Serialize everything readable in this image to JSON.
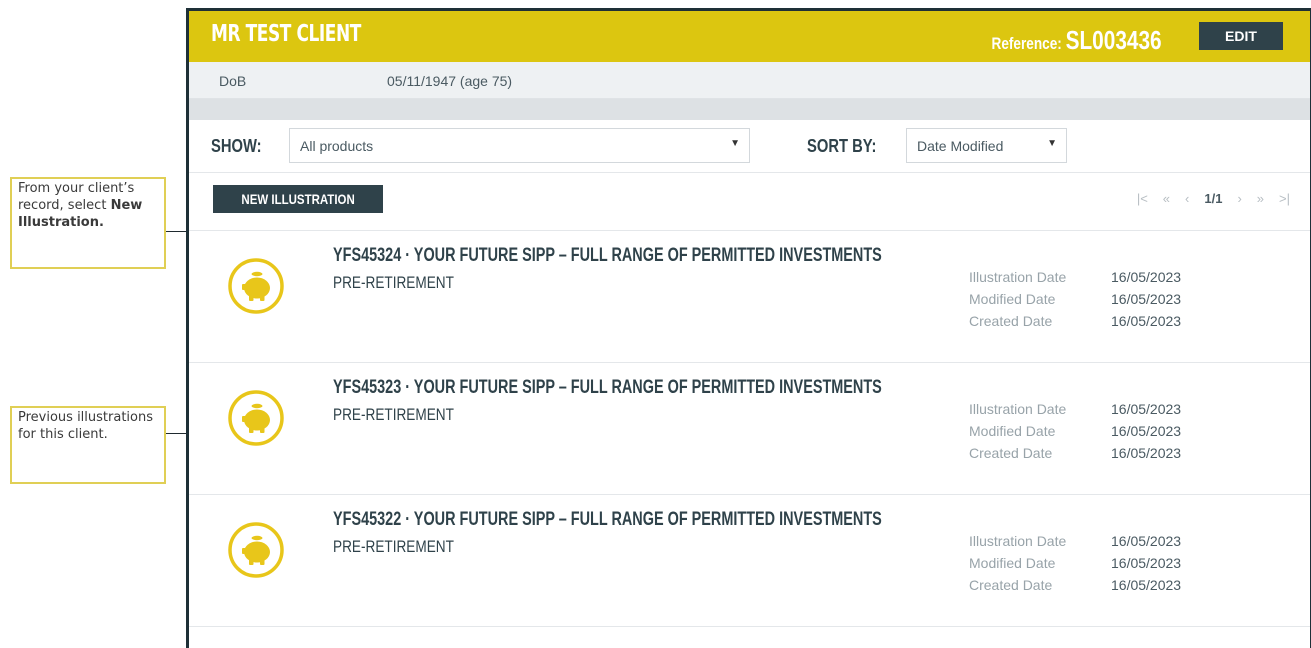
{
  "callouts": {
    "new_illustration_pre": "From your client’s record, select ",
    "new_illustration_bold": "New Illustration.",
    "previous": "Previous illustrations for this client."
  },
  "header": {
    "client_name": "MR TEST CLIENT",
    "reference_label": "Reference:",
    "reference_value": "SL003436",
    "edit_label": "EDIT"
  },
  "dob": {
    "label": "DoB",
    "value": "05/11/1947 (age 75)"
  },
  "filters": {
    "show_label": "SHOW:",
    "show_value": "All products",
    "sort_label": "SORT BY:",
    "sort_value": "Date Modified"
  },
  "actions": {
    "new_illustration_label": "NEW ILLUSTRATION"
  },
  "pager": {
    "first": "|<",
    "prev_page": "«",
    "prev": "‹",
    "current": "1/1",
    "next": "›",
    "next_page": "»",
    "last": ">|"
  },
  "illustrations": [
    {
      "title": "YFS45324 · YOUR FUTURE SIPP – FULL RANGE OF PERMITTED INVESTMENTS",
      "subtitle": "PRE-RETIREMENT",
      "illustration_date_label": "Illustration Date",
      "illustration_date": "16/05/2023",
      "modified_date_label": "Modified Date",
      "modified_date": "16/05/2023",
      "created_date_label": "Created Date",
      "created_date": "16/05/2023"
    },
    {
      "title": "YFS45323 · YOUR FUTURE SIPP – FULL RANGE OF PERMITTED INVESTMENTS",
      "subtitle": "PRE-RETIREMENT",
      "illustration_date_label": "Illustration Date",
      "illustration_date": "16/05/2023",
      "modified_date_label": "Modified Date",
      "modified_date": "16/05/2023",
      "created_date_label": "Created Date",
      "created_date": "16/05/2023"
    },
    {
      "title": "YFS45322 · YOUR FUTURE SIPP – FULL RANGE OF PERMITTED INVESTMENTS",
      "subtitle": "PRE-RETIREMENT",
      "illustration_date_label": "Illustration Date",
      "illustration_date": "16/05/2023",
      "modified_date_label": "Modified Date",
      "modified_date": "16/05/2023",
      "created_date_label": "Created Date",
      "created_date": "16/05/2023"
    }
  ],
  "colors": {
    "brand_yellow": "#dcc610",
    "dark_slate": "#2f424a",
    "icon_yellow": "#e8c61a"
  },
  "icons": {
    "product_icon": "piggy-bank-icon",
    "select_chevron": "chevron-down-icon"
  }
}
